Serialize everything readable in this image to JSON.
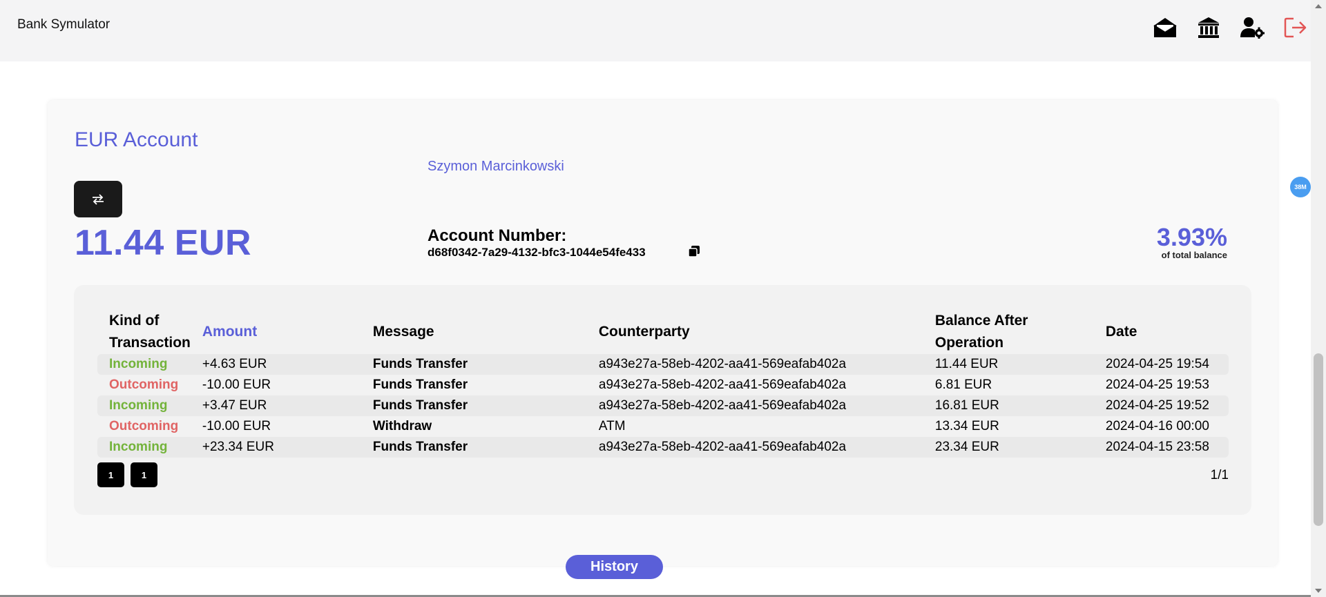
{
  "header": {
    "app_title": "Bank Symulator",
    "icons": [
      "mail-open-icon",
      "bank-icon",
      "user-settings-icon",
      "logout-icon"
    ]
  },
  "account": {
    "title": "EUR Account",
    "owner": "Szymon Marcinkowski",
    "balance": "11.44 EUR",
    "number_label": "Account Number:",
    "number": "d68f0342-7a29-4132-bfc3-1044e54fe433",
    "share_percent": "3.93%",
    "share_label": "of total balance"
  },
  "table": {
    "headers": [
      "Kind of Transaction",
      "Amount",
      "Message",
      "Counterparty",
      "Balance After Operation",
      "Date"
    ],
    "header_lines": [
      [
        "Kind of",
        "Transaction"
      ],
      [
        "Amount"
      ],
      [
        "Message"
      ],
      [
        "Counterparty"
      ],
      [
        "Balance After",
        "Operation"
      ],
      [
        "Date"
      ]
    ],
    "rows": [
      {
        "kind": "Incoming",
        "amount": "+4.63 EUR",
        "message": "Funds Transfer",
        "counterparty": "a943e27a-58eb-4202-aa41-569eafab402a",
        "balance_after": "11.44 EUR",
        "date": "2024-04-25 19:54"
      },
      {
        "kind": "Outcoming",
        "amount": "-10.00 EUR",
        "message": "Funds Transfer",
        "counterparty": "a943e27a-58eb-4202-aa41-569eafab402a",
        "balance_after": "6.81 EUR",
        "date": "2024-04-25 19:53"
      },
      {
        "kind": "Incoming",
        "amount": "+3.47 EUR",
        "message": "Funds Transfer",
        "counterparty": "a943e27a-58eb-4202-aa41-569eafab402a",
        "balance_after": "16.81 EUR",
        "date": "2024-04-25 19:52"
      },
      {
        "kind": "Outcoming",
        "amount": "-10.00 EUR",
        "message": "Withdraw",
        "counterparty": "ATM",
        "balance_after": "13.34 EUR",
        "date": "2024-04-16 00:00"
      },
      {
        "kind": "Incoming",
        "amount": "+23.34 EUR",
        "message": "Funds Transfer",
        "counterparty": "a943e27a-58eb-4202-aa41-569eafab402a",
        "balance_after": "23.34 EUR",
        "date": "2024-04-15 23:58"
      }
    ]
  },
  "pagination": {
    "buttons": [
      "1",
      "1"
    ],
    "info": "1/1"
  },
  "history_button": "History",
  "badge": "38M",
  "colors": {
    "accent": "#5a5fd8",
    "incoming": "#73b33a",
    "outcoming": "#e06464",
    "logout": "#e25555"
  }
}
